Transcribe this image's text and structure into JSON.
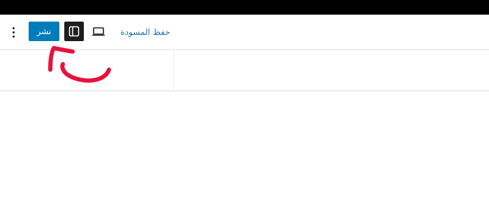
{
  "toolbar": {
    "publish_label": "نشر",
    "save_draft_label": "حفظ المسودة",
    "icons": {
      "more": "vertical-ellipsis-icon",
      "sidebar_toggle": "sidebar-panel-icon",
      "preview": "laptop-icon"
    }
  },
  "colors": {
    "top_bar": "#000000",
    "publish_button": "#007cba",
    "sidebar_toggle_active": "#1e1e1e",
    "link": "#2271b1",
    "annotation_arrow": "#e8123c"
  }
}
